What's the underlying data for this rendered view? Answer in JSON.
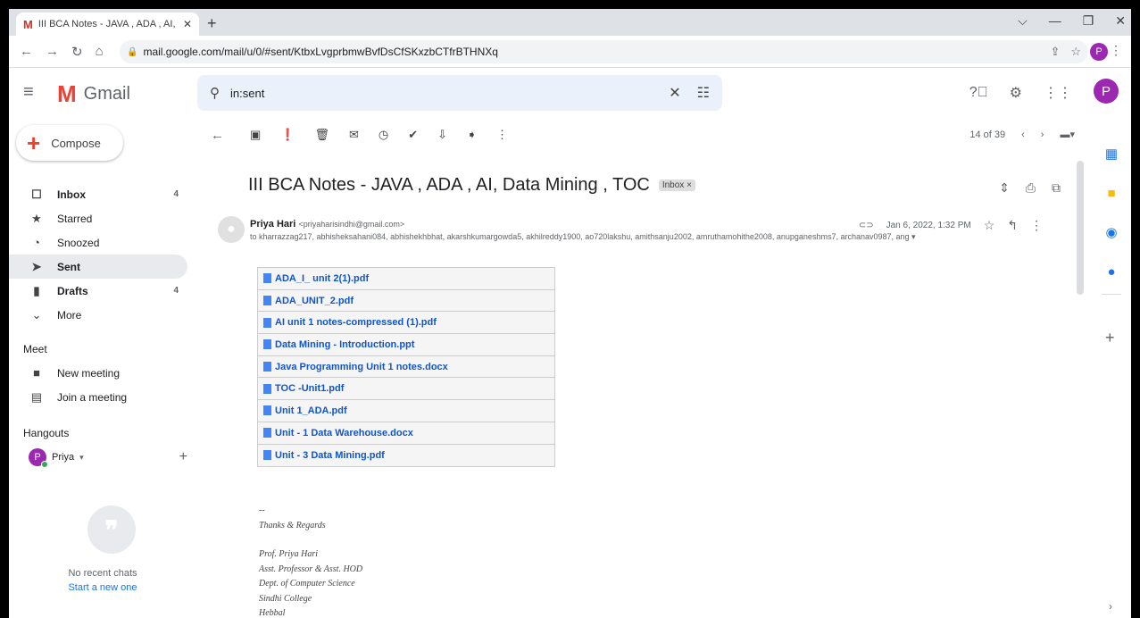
{
  "browser": {
    "tab_title": "III BCA Notes - JAVA , ADA , AI, D",
    "tab_close": "✕",
    "new_tab": "+",
    "url": "mail.google.com/mail/u/0/#sent/KtbxLvgprbmwBvfDsCfSKxzbCTfrBTHNXq",
    "profile_initial": "P"
  },
  "gmail": {
    "logo_text": "Gmail",
    "search_value": "in:sent",
    "avatar_initial": "P"
  },
  "compose_label": "Compose",
  "nav": [
    {
      "label": "Inbox",
      "count": "4",
      "icon": "inbox-icon",
      "bold": true
    },
    {
      "label": "Starred",
      "count": "",
      "icon": "star-icon",
      "bold": false
    },
    {
      "label": "Snoozed",
      "count": "",
      "icon": "clock-icon",
      "bold": false
    },
    {
      "label": "Sent",
      "count": "",
      "icon": "send-icon",
      "bold": true
    },
    {
      "label": "Drafts",
      "count": "4",
      "icon": "draft-icon",
      "bold": true
    },
    {
      "label": "More",
      "count": "",
      "icon": "chevron-down-icon",
      "bold": false
    }
  ],
  "meet": {
    "title": "Meet",
    "new_meeting": "New meeting",
    "join_meeting": "Join a meeting"
  },
  "hangouts": {
    "title": "Hangouts",
    "user_initial": "P",
    "user_name": "Priya",
    "no_chats": "No recent chats",
    "start_new": "Start a new one"
  },
  "message": {
    "pager": "14 of 39",
    "subject": "III BCA Notes - JAVA , ADA , AI, Data Mining , TOC",
    "label": "Inbox ×",
    "sender_name": "Priya Hari",
    "sender_email": "<priyaharisindhi@gmail.com>",
    "recipients": "to kharrazzag217, abhisheksahani084, abhishekhbhat, akarshkumargowda5, akhilreddy1900, ao720lakshu, amithsanju2002, amruthamohithe2008, anupganeshms7, archanav0987, ang ▾",
    "date": "Jan 6, 2022, 1:32 PM",
    "attachments": [
      "ADA_I_ unit 2(1).pdf",
      "ADA_UNIT_2.pdf",
      "AI unit 1 notes-compressed (1).pdf",
      "Data Mining - Introduction.ppt",
      "Java Programming Unit 1 notes.docx",
      "TOC -Unit1.pdf",
      "Unit 1_ADA.pdf",
      "Unit - 1 Data Warehouse.docx",
      "Unit - 3 Data Mining.pdf"
    ],
    "signature": {
      "dash": "--",
      "regards": "Thanks & Regards",
      "name": "Prof. Priya Hari",
      "title": "Asst. Professor & Asst. HOD",
      "dept": "Dept. of Computer Science",
      "college": "Sindhi College",
      "place": "Hebbal"
    }
  }
}
